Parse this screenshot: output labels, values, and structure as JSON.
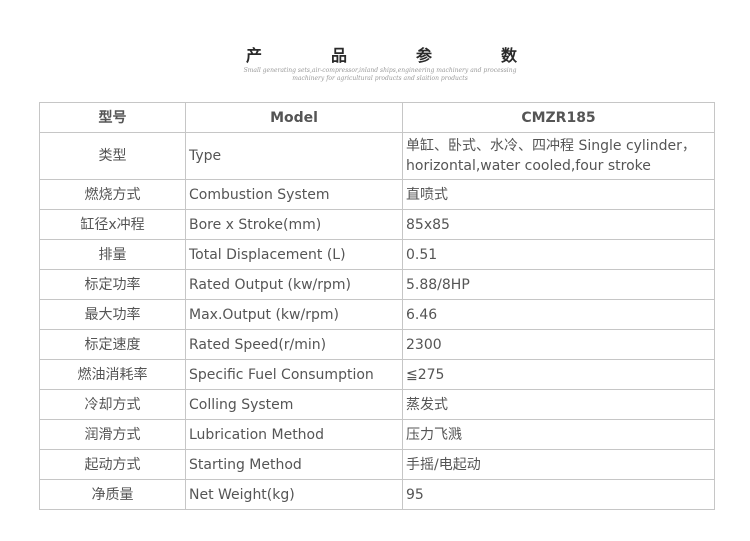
{
  "header": {
    "title_chars": [
      "产",
      "品",
      "参",
      "数"
    ],
    "subtitle_line1": "Small generating sets,air-compressor,inland ships,engineering machinery and processing",
    "subtitle_line2": "machinery for agricultural products and slaition products"
  },
  "table": {
    "headers": [
      "型号",
      "Model",
      "CMZR185"
    ],
    "rows": [
      [
        "类型",
        "Type",
        "单缸、卧式、水冷、四冲程 Single cylinder，horizontal,water cooled,four stroke"
      ],
      [
        "燃烧方式",
        "Combustion System",
        "直喷式"
      ],
      [
        "缸径x冲程",
        "Bore x Stroke(mm)",
        "85x85"
      ],
      [
        "排量",
        "Total Displacement (L)",
        "0.51"
      ],
      [
        "标定功率",
        "Rated Output (kw/rpm)",
        "5.88/8HP"
      ],
      [
        "最大功率",
        "Max.Output (kw/rpm)",
        "6.46"
      ],
      [
        "标定速度",
        "Rated Speed(r/min)",
        "2300"
      ],
      [
        "燃油消耗率",
        "Specific Fuel Consumption",
        "≦275"
      ],
      [
        "冷却方式",
        "Colling System",
        "蒸发式"
      ],
      [
        "润滑方式",
        "Lubrication Method",
        "压力飞溅"
      ],
      [
        "起动方式",
        "Starting Method",
        "手摇/电起动"
      ],
      [
        "净质量",
        "Net  Weight(kg)",
        "95"
      ]
    ]
  }
}
